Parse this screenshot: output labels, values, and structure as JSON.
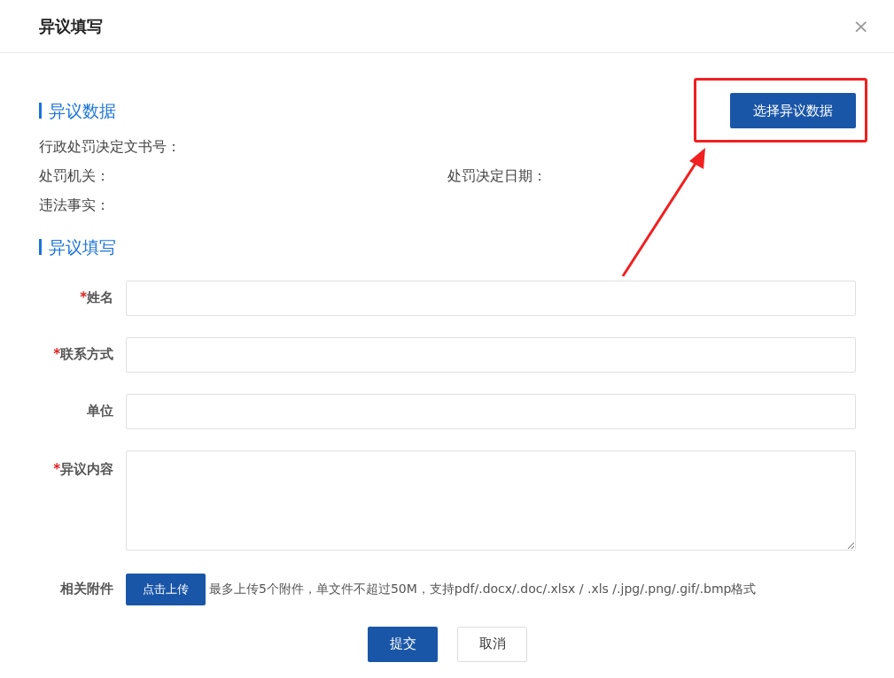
{
  "dialog": {
    "title": "异议填写",
    "close": "×"
  },
  "data_section": {
    "heading": "异议数据",
    "select_button": "选择异议数据",
    "rows": [
      [
        "行政处罚决定文书号："
      ],
      [
        "处罚机关：",
        "处罚决定日期："
      ],
      [
        "违法事实："
      ]
    ]
  },
  "form_section": {
    "heading": "异议填写",
    "fields": [
      {
        "required_mark": "*",
        "label": "姓名",
        "kind": "input"
      },
      {
        "required_mark": "*",
        "label": "联系方式",
        "kind": "input"
      },
      {
        "label": "单位",
        "kind": "input"
      },
      {
        "required_mark": "*",
        "label": "异议内容",
        "kind": "textarea"
      }
    ],
    "attachment": {
      "label": "相关附件",
      "button": "点击上传",
      "hint": "最多上传5个附件，单文件不超过50M，支持pdf/.docx/.doc/.xlsx / .xls /.jpg/.png/.gif/.bmp格式"
    }
  },
  "buttons": [
    {
      "label": "提交",
      "kind": "primary"
    },
    {
      "label": "取消",
      "kind": "secondary"
    }
  ]
}
